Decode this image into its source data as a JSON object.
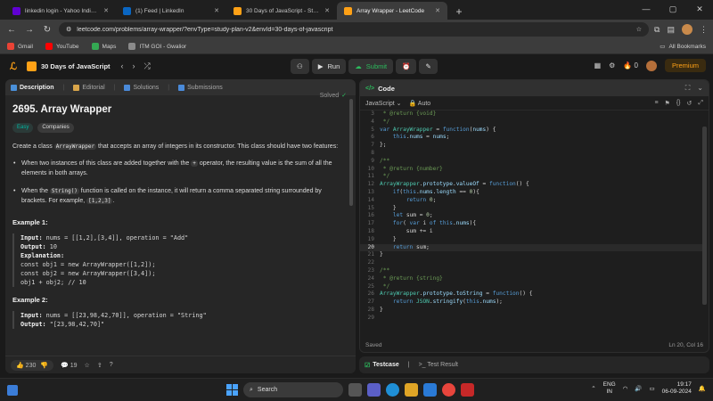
{
  "browser": {
    "tabs": [
      {
        "title": "linkedin login - Yahoo India Se",
        "color": "#6001d2",
        "active": false
      },
      {
        "title": "(1) Feed | LinkedIn",
        "color": "#0a66c2",
        "active": false
      },
      {
        "title": "30 Days of JavaScript - Study P",
        "color": "#ffa116",
        "active": false
      },
      {
        "title": "Array Wrapper - LeetCode",
        "color": "#ffa116",
        "active": true
      }
    ],
    "url": "leetcode.com/problems/array-wrapper/?envType=study-plan-v2&envId=30-days-of-javascript",
    "bookmarks": [
      {
        "label": "Gmail",
        "color": "#ea4335"
      },
      {
        "label": "YouTube",
        "color": "#ff0000"
      },
      {
        "label": "Maps",
        "color": "#34a853"
      },
      {
        "label": "ITM GOI - Gwalior",
        "color": "#8a8a8a"
      }
    ],
    "all_bookmarks": "All Bookmarks"
  },
  "lc_nav": {
    "plan_name": "30 Days of JavaScript",
    "run_label": "Run",
    "submit_label": "Submit",
    "fire_count": "0",
    "premium_label": "Premium"
  },
  "left": {
    "tabs": [
      "Description",
      "Editorial",
      "Solutions",
      "Submissions"
    ],
    "title": "2695. Array Wrapper",
    "solved": "Solved",
    "chips": [
      "Easy",
      "Companies"
    ],
    "desc_1": "Create a class",
    "desc_code": "ArrayWrapper",
    "desc_2": "that accepts an array of integers in its constructor. This class should have two features:",
    "bullet1_a": "When two instances of this class are added together with the",
    "bullet1_code": "+",
    "bullet1_b": "operator, the resulting value is the sum of all the elements in both arrays.",
    "bullet2_a": "When the",
    "bullet2_code": "String()",
    "bullet2_b": "function is called on the instance, it will return a comma separated string surrounded by brackets. For example,",
    "bullet2_code2": "[1,2,3]",
    "bullet2_c": ".",
    "example1_title": "Example 1:",
    "example1": {
      "input_label": "Input:",
      "input": " nums = [[1,2],[3,4]], operation = \"Add\"",
      "output_label": "Output:",
      "output": " 10",
      "expl_label": "Explanation:",
      "lines": [
        "const obj1 = new ArrayWrapper([1,2]);",
        "const obj2 = new ArrayWrapper([3,4]);",
        "obj1 + obj2; // 10"
      ]
    },
    "example2_title": "Example 2:",
    "example2": {
      "input_label": "Input:",
      "input": " nums = [[23,98,42,70]], operation = \"String\"",
      "output_label": "Output:",
      "output": " \"[23,98,42,70]\""
    },
    "footer": {
      "likes": "230",
      "comments": "19"
    }
  },
  "right": {
    "header": "Code",
    "language": "JavaScript",
    "mode": "Auto",
    "status_left": "Saved",
    "status_right": "Ln 20, Col 16",
    "code_lines": [
      {
        "n": "3",
        "t": " * @return {void}"
      },
      {
        "n": "4",
        "t": " */"
      },
      {
        "n": "5",
        "t": "var ArrayWrapper = function(nums) {"
      },
      {
        "n": "6",
        "t": "    this.nums = nums;"
      },
      {
        "n": "7",
        "t": "};"
      },
      {
        "n": "8",
        "t": ""
      },
      {
        "n": "9",
        "t": "/**"
      },
      {
        "n": "10",
        "t": " * @return {number}"
      },
      {
        "n": "11",
        "t": " */"
      },
      {
        "n": "12",
        "t": "ArrayWrapper.prototype.valueOf = function() {"
      },
      {
        "n": "13",
        "t": "    if(this.nums.length == 0){"
      },
      {
        "n": "14",
        "t": "        return 0;"
      },
      {
        "n": "15",
        "t": "    }"
      },
      {
        "n": "16",
        "t": "    let sum = 0;"
      },
      {
        "n": "17",
        "t": "    for( var i of this.nums){"
      },
      {
        "n": "18",
        "t": "        sum += i"
      },
      {
        "n": "19",
        "t": "    }"
      },
      {
        "n": "20",
        "t": "    return sum;"
      },
      {
        "n": "21",
        "t": "}"
      },
      {
        "n": "22",
        "t": ""
      },
      {
        "n": "23",
        "t": "/**"
      },
      {
        "n": "24",
        "t": " * @return {string}"
      },
      {
        "n": "25",
        "t": " */"
      },
      {
        "n": "26",
        "t": "ArrayWrapper.prototype.toString = function() {"
      },
      {
        "n": "27",
        "t": "    return JSON.stringify(this.nums);"
      },
      {
        "n": "28",
        "t": "}"
      },
      {
        "n": "29",
        "t": ""
      }
    ],
    "current_line": "20"
  },
  "testpanel": {
    "testcase": "Testcase",
    "result": "Test Result"
  },
  "taskbar": {
    "search": "Search",
    "lang_top": "ENG",
    "lang_bottom": "IN",
    "time": "19:17",
    "date": "06-09-2024"
  }
}
